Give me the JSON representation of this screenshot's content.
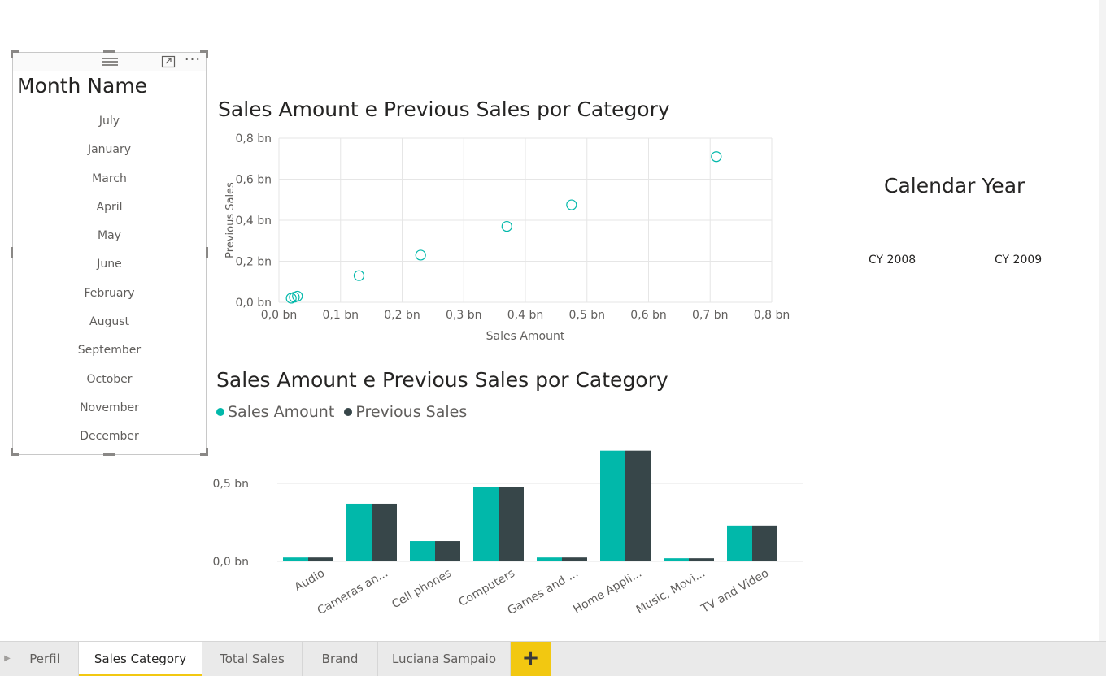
{
  "slicer_month": {
    "title": "Month Name",
    "items": [
      "July",
      "January",
      "March",
      "April",
      "May",
      "June",
      "February",
      "August",
      "September",
      "October",
      "November",
      "December"
    ]
  },
  "slicer_year": {
    "title": "Calendar Year",
    "items": [
      "CY 2008",
      "CY 2009"
    ]
  },
  "scatter": {
    "title": "Sales Amount e Previous Sales por Category"
  },
  "bar": {
    "title": "Sales Amount e Previous Sales por Category",
    "legend": [
      "Sales Amount",
      "Previous Sales"
    ]
  },
  "colors": {
    "sales_amount": "#01B8AA",
    "previous_sales": "#374649",
    "accent": "#F2C811"
  },
  "icons": {
    "focus": "focus-mode-icon",
    "more": "more-options-icon",
    "drag": "drag-grip-icon",
    "add": "add-page-icon"
  },
  "tabs": {
    "items": [
      "Perfil",
      "Sales Category",
      "Total Sales",
      "Brand",
      "Luciana Sampaio"
    ],
    "active": "Sales Category",
    "add_label": "+"
  },
  "chart_data": [
    {
      "type": "scatter",
      "title": "Sales Amount e Previous Sales por Category",
      "xlabel": "Sales Amount",
      "ylabel": "Previous Sales",
      "xlim": [
        0,
        0.8
      ],
      "ylim": [
        0,
        0.8
      ],
      "xticks": [
        "0,0 bn",
        "0,1 bn",
        "0,2 bn",
        "0,3 bn",
        "0,4 bn",
        "0,5 bn",
        "0,6 bn",
        "0,7 bn",
        "0,8 bn"
      ],
      "yticks": [
        "0,0 bn",
        "0,2 bn",
        "0,4 bn",
        "0,6 bn",
        "0,8 bn"
      ],
      "grid": true,
      "points": [
        {
          "x": 0.02,
          "y": 0.02
        },
        {
          "x": 0.025,
          "y": 0.025
        },
        {
          "x": 0.03,
          "y": 0.03
        },
        {
          "x": 0.13,
          "y": 0.13
        },
        {
          "x": 0.23,
          "y": 0.23
        },
        {
          "x": 0.37,
          "y": 0.37
        },
        {
          "x": 0.475,
          "y": 0.475
        },
        {
          "x": 0.71,
          "y": 0.71
        }
      ]
    },
    {
      "type": "bar",
      "title": "Sales Amount e Previous Sales por Category",
      "categories": [
        "Audio",
        "Cameras an...",
        "Cell phones",
        "Computers",
        "Games and ...",
        "Home Appli...",
        "Music, Movi...",
        "TV and Video"
      ],
      "series": [
        {
          "name": "Sales Amount",
          "values": [
            0.025,
            0.37,
            0.13,
            0.475,
            0.025,
            0.71,
            0.02,
            0.23
          ]
        },
        {
          "name": "Previous Sales",
          "values": [
            0.025,
            0.37,
            0.13,
            0.475,
            0.025,
            0.71,
            0.02,
            0.23
          ]
        }
      ],
      "yticks": [
        "0,0 bn",
        "0,5 bn"
      ],
      "ylim": [
        0,
        0.75
      ],
      "legend": "top-left",
      "grid": true
    }
  ]
}
